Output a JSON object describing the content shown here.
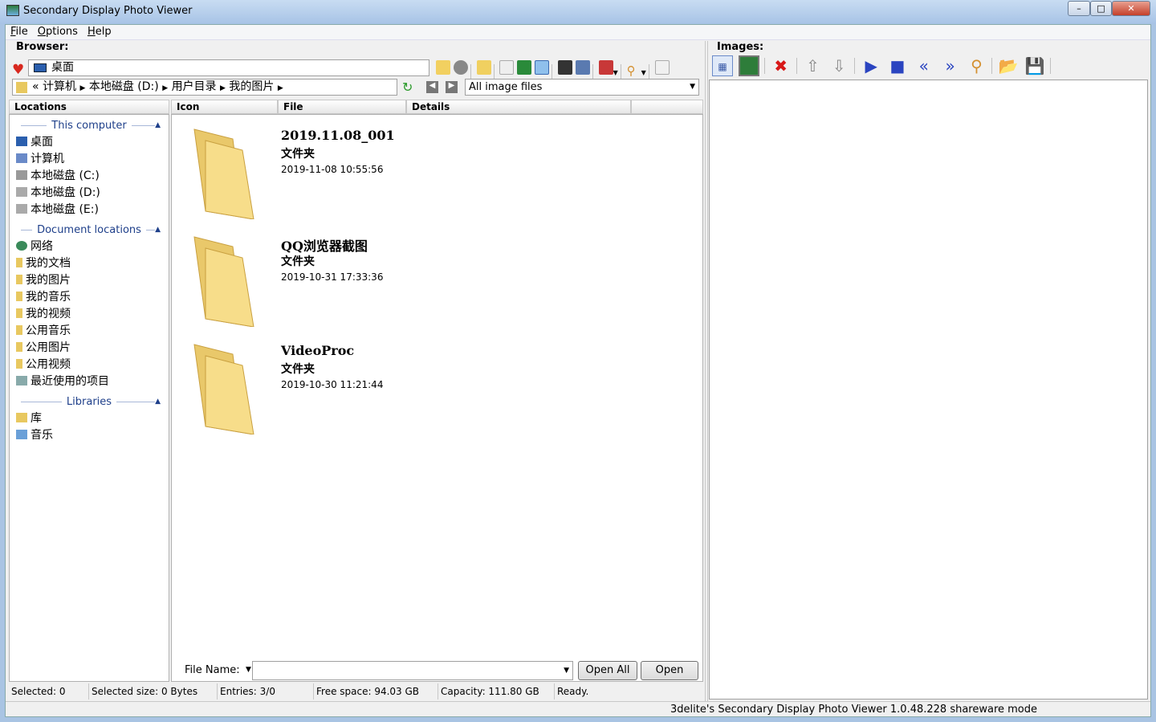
{
  "window": {
    "title": "Secondary Display Photo Viewer",
    "minimize": "–",
    "maximize": "□",
    "close": "✕"
  },
  "menu": [
    {
      "label": "File",
      "key": "F",
      "rest": "ile"
    },
    {
      "label": "Options",
      "key": "O",
      "rest": "ptions"
    },
    {
      "label": "Help",
      "key": "H",
      "rest": "elp"
    }
  ],
  "browser": {
    "label": "Browser:",
    "address": "桌面",
    "breadcrumb": [
      "«",
      "计算机",
      "本地磁盘 (D:)",
      "用户目录",
      "我的图片"
    ],
    "filter": "All image files",
    "columns": {
      "locations": "Locations",
      "icon": "Icon",
      "file": "File",
      "details": "Details"
    }
  },
  "locations": {
    "sections": [
      {
        "title": "This computer",
        "items": [
          "桌面",
          "计算机",
          "本地磁盘 (C:)",
          "本地磁盘 (D:)",
          "本地磁盘 (E:)"
        ]
      },
      {
        "title": "Document locations",
        "items": [
          "网络",
          "我的文档",
          "我的图片",
          "我的音乐",
          "我的视频",
          "公用音乐",
          "公用图片",
          "公用视频",
          "最近使用的项目"
        ]
      },
      {
        "title": "Libraries",
        "items": [
          "库",
          "音乐"
        ]
      }
    ]
  },
  "files": [
    {
      "name": "2019.11.08_001",
      "type": "文件夹",
      "date": "2019-11-08 10:55:56"
    },
    {
      "name": "QQ浏览器截图",
      "type": "文件夹",
      "date": "2019-10-31 17:33:36"
    },
    {
      "name": "VideoProc",
      "type": "文件夹",
      "date": "2019-10-30 11:21:44"
    }
  ],
  "filename": {
    "label": "File Name:",
    "value": "",
    "open_all": "Open All",
    "open": "Open"
  },
  "status": {
    "selected": "Selected: 0",
    "size": "Selected size: 0 Bytes",
    "entries": "Entries: 3/0",
    "free": "Free space: 94.03 GB",
    "capacity": "Capacity: 111.80 GB",
    "state": "Ready."
  },
  "images": {
    "label": "Images:"
  },
  "footer": "3delite's Secondary Display Photo Viewer 1.0.48.228 shareware mode"
}
